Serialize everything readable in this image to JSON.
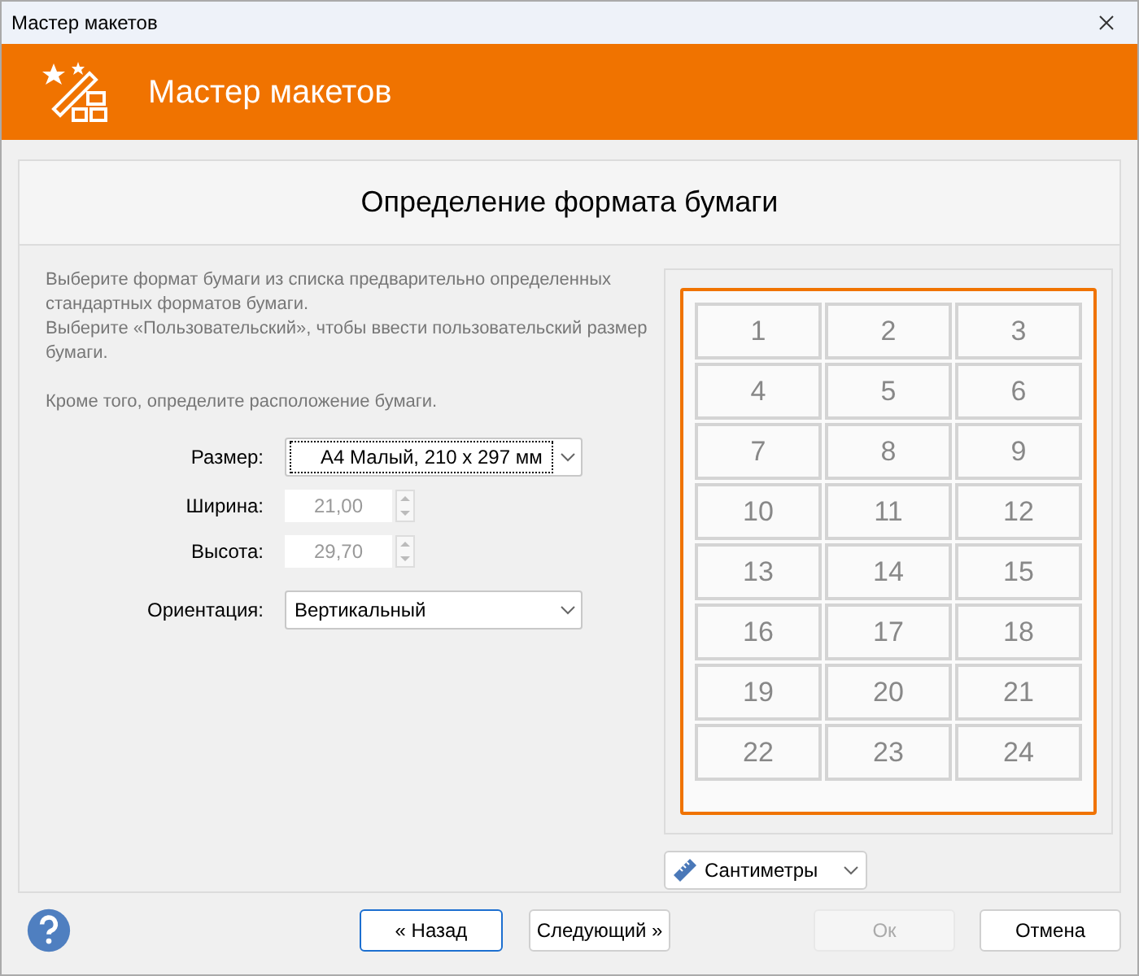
{
  "window": {
    "title": "Мастер макетов"
  },
  "header": {
    "title": "Мастер макетов"
  },
  "page_title": "Определение формата бумаги",
  "description": [
    "Выберите формат бумаги из списка предварительно определенных стандартных форматов бумаги.",
    "Выберите «Пользовательский», чтобы ввести пользовательский размер бумаги.",
    "Кроме того, определите расположение бумаги."
  ],
  "fields": [
    {
      "kind": "dropdown",
      "label": "Размер:",
      "value": "А4 Малый, 210 x 297 мм",
      "focused": true,
      "disabled": false
    },
    {
      "kind": "spinner",
      "label": "Ширина:",
      "value": "21,00",
      "disabled": true
    },
    {
      "kind": "spinner",
      "label": "Высота:",
      "value": "29,70",
      "disabled": true
    },
    {
      "kind": "dropdown",
      "label": "Ориентация:",
      "value": "Вертикальный",
      "focused": false,
      "disabled": false
    }
  ],
  "preview": {
    "labels": [
      "1",
      "2",
      "3",
      "4",
      "5",
      "6",
      "7",
      "8",
      "9",
      "10",
      "11",
      "12",
      "13",
      "14",
      "15",
      "16",
      "17",
      "18",
      "19",
      "20",
      "21",
      "22",
      "23",
      "24"
    ]
  },
  "units": {
    "value": "Сантиметры"
  },
  "buttons": [
    {
      "label": "« Назад",
      "disabled": false,
      "default": true
    },
    {
      "label": "Следующий »",
      "disabled": false,
      "default": false
    },
    {
      "label": "Ок",
      "disabled": true,
      "default": false
    },
    {
      "label": "Отмена",
      "disabled": false,
      "default": false
    }
  ]
}
